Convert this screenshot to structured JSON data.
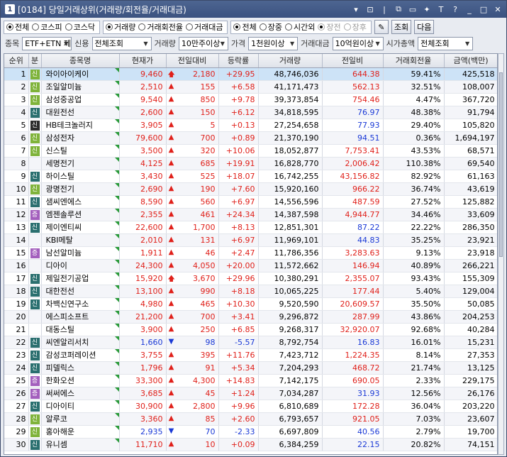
{
  "window": {
    "screen_no": "1",
    "title": "[0184] 당일거래상위(거래량/회전율/거래대금)"
  },
  "market_radios": [
    {
      "label": "전체",
      "selected": true
    },
    {
      "label": "코스피",
      "selected": false
    },
    {
      "label": "코스닥",
      "selected": false
    }
  ],
  "sort_radios": [
    {
      "label": "거래량",
      "selected": true
    },
    {
      "label": "거래회전율",
      "selected": false
    },
    {
      "label": "거래대금",
      "selected": false
    }
  ],
  "session_radios": [
    {
      "label": "전체",
      "selected": true,
      "disabled": false
    },
    {
      "label": "장중",
      "selected": false,
      "disabled": false
    },
    {
      "label": "시간외",
      "selected": false,
      "disabled": false
    },
    {
      "label": "장전",
      "selected": true,
      "disabled": true
    },
    {
      "label": "장후",
      "selected": false,
      "disabled": true
    }
  ],
  "buttons": {
    "query": "조회",
    "next": "다음"
  },
  "filters": {
    "stock_label": "종목",
    "stock_value": "ETF+ETN 제",
    "credit_label": "신용",
    "credit_value": "전체조회",
    "volume_label": "거래량",
    "volume_value": "10만주이상",
    "price_label": "가격",
    "price_value": "1천원이상",
    "amount_label": "거래대금",
    "amount_value": "10억원이상",
    "mcap_label": "시가총액",
    "mcap_value": "전체조회"
  },
  "columns": [
    "순위",
    "분",
    "종목명",
    "현재가",
    "전일대비",
    "등락률",
    "거래량",
    "전일비",
    "거래회전율",
    "금액(백만)"
  ],
  "rows": [
    {
      "rank": "1",
      "tag": "신",
      "tagc": "g",
      "name": "와이아이케이",
      "price": "9,460",
      "arrow": "up-big",
      "chg": "2,180",
      "rate": "+29.95",
      "vol": "48,746,036",
      "prev": "644.38",
      "prevc": "up",
      "turn": "59.41%",
      "amt": "425,518"
    },
    {
      "rank": "2",
      "tag": "신",
      "tagc": "g",
      "name": "조일알미늄",
      "price": "2,510",
      "arrow": "up",
      "chg": "155",
      "rate": "+6.58",
      "vol": "41,171,473",
      "prev": "562.13",
      "prevc": "up",
      "turn": "32.51%",
      "amt": "108,007"
    },
    {
      "rank": "3",
      "tag": "신",
      "tagc": "g",
      "name": "삼성중공업",
      "price": "9,540",
      "arrow": "up",
      "chg": "850",
      "rate": "+9.78",
      "vol": "39,373,854",
      "prev": "754.46",
      "prevc": "up",
      "turn": "4.47%",
      "amt": "367,720"
    },
    {
      "rank": "4",
      "tag": "신",
      "tagc": "t",
      "name": "대원전선",
      "price": "2,600",
      "arrow": "up",
      "chg": "150",
      "rate": "+6.12",
      "vol": "34,818,595",
      "prev": "76.97",
      "prevc": "dn",
      "turn": "48.38%",
      "amt": "91,794"
    },
    {
      "rank": "5",
      "tag": "신",
      "tagc": "b",
      "name": "HB테크놀러지",
      "price": "3,905",
      "arrow": "up",
      "chg": "5",
      "rate": "+0.13",
      "vol": "27,254,658",
      "prev": "77.93",
      "prevc": "dn",
      "turn": "29.40%",
      "amt": "105,820"
    },
    {
      "rank": "6",
      "tag": "신",
      "tagc": "g",
      "name": "삼성전자",
      "price": "79,600",
      "arrow": "up",
      "chg": "700",
      "rate": "+0.89",
      "vol": "21,370,190",
      "prev": "94.51",
      "prevc": "dn",
      "turn": "0.36%",
      "amt": "1,694,197"
    },
    {
      "rank": "7",
      "tag": "신",
      "tagc": "g",
      "name": "신스틸",
      "price": "3,500",
      "arrow": "up",
      "chg": "320",
      "rate": "+10.06",
      "vol": "18,052,877",
      "prev": "7,753.41",
      "prevc": "up",
      "turn": "43.53%",
      "amt": "68,571"
    },
    {
      "rank": "8",
      "tag": "",
      "tagc": "",
      "name": "세명전기",
      "price": "4,125",
      "arrow": "up",
      "chg": "685",
      "rate": "+19.91",
      "vol": "16,828,770",
      "prev": "2,006.42",
      "prevc": "up",
      "turn": "110.38%",
      "amt": "69,540"
    },
    {
      "rank": "9",
      "tag": "신",
      "tagc": "t",
      "name": "하이스틸",
      "price": "3,430",
      "arrow": "up",
      "chg": "525",
      "rate": "+18.07",
      "vol": "16,742,255",
      "prev": "43,156.82",
      "prevc": "up",
      "turn": "82.92%",
      "amt": "61,163"
    },
    {
      "rank": "10",
      "tag": "신",
      "tagc": "g",
      "name": "광명전기",
      "price": "2,690",
      "arrow": "up",
      "chg": "190",
      "rate": "+7.60",
      "vol": "15,920,160",
      "prev": "966.22",
      "prevc": "up",
      "turn": "36.74%",
      "amt": "43,619"
    },
    {
      "rank": "11",
      "tag": "신",
      "tagc": "t",
      "name": "샘씨엔에스",
      "price": "8,590",
      "arrow": "up",
      "chg": "560",
      "rate": "+6.97",
      "vol": "14,556,596",
      "prev": "487.59",
      "prevc": "up",
      "turn": "27.52%",
      "amt": "125,882"
    },
    {
      "rank": "12",
      "tag": "증",
      "tagc": "p",
      "name": "엠젠솔루션",
      "price": "2,355",
      "arrow": "up",
      "chg": "461",
      "rate": "+24.34",
      "vol": "14,387,598",
      "prev": "4,944.77",
      "prevc": "up",
      "turn": "34.46%",
      "amt": "33,609"
    },
    {
      "rank": "13",
      "tag": "신",
      "tagc": "t",
      "name": "제이엔티씨",
      "price": "22,600",
      "arrow": "up",
      "chg": "1,700",
      "rate": "+8.13",
      "vol": "12,851,301",
      "prev": "87.22",
      "prevc": "dn",
      "turn": "22.22%",
      "amt": "286,350"
    },
    {
      "rank": "14",
      "tag": "",
      "tagc": "",
      "name": "KBI메탈",
      "price": "2,010",
      "arrow": "up",
      "chg": "131",
      "rate": "+6.97",
      "vol": "11,969,101",
      "prev": "44.83",
      "prevc": "dn",
      "turn": "35.25%",
      "amt": "23,921"
    },
    {
      "rank": "15",
      "tag": "증",
      "tagc": "p",
      "name": "남선알미늄",
      "price": "1,911",
      "arrow": "up",
      "chg": "46",
      "rate": "+2.47",
      "vol": "11,786,356",
      "prev": "3,283.63",
      "prevc": "up",
      "turn": "9.13%",
      "amt": "23,918"
    },
    {
      "rank": "16",
      "tag": "",
      "tagc": "",
      "name": "디아이",
      "price": "24,300",
      "arrow": "up",
      "chg": "4,050",
      "rate": "+20.00",
      "vol": "11,572,662",
      "prev": "146.94",
      "prevc": "up",
      "turn": "40.89%",
      "amt": "266,221"
    },
    {
      "rank": "17",
      "tag": "신",
      "tagc": "t",
      "name": "제일전기공업",
      "price": "15,920",
      "arrow": "up-big",
      "chg": "3,670",
      "rate": "+29.96",
      "vol": "10,380,291",
      "prev": "2,355.07",
      "prevc": "up",
      "turn": "93.43%",
      "amt": "155,309"
    },
    {
      "rank": "18",
      "tag": "신",
      "tagc": "t",
      "name": "대한전선",
      "price": "13,100",
      "arrow": "up",
      "chg": "990",
      "rate": "+8.18",
      "vol": "10,065,225",
      "prev": "177.44",
      "prevc": "up",
      "turn": "5.40%",
      "amt": "129,004"
    },
    {
      "rank": "19",
      "tag": "신",
      "tagc": "t",
      "name": "차백신연구소",
      "price": "4,980",
      "arrow": "up",
      "chg": "465",
      "rate": "+10.30",
      "vol": "9,520,590",
      "prev": "20,609.57",
      "prevc": "up",
      "turn": "35.50%",
      "amt": "50,085"
    },
    {
      "rank": "20",
      "tag": "",
      "tagc": "",
      "name": "에스피소프트",
      "price": "21,200",
      "arrow": "up",
      "chg": "700",
      "rate": "+3.41",
      "vol": "9,296,872",
      "prev": "287.99",
      "prevc": "up",
      "turn": "43.86%",
      "amt": "204,253"
    },
    {
      "rank": "21",
      "tag": "",
      "tagc": "",
      "name": "대동스틸",
      "price": "3,900",
      "arrow": "up",
      "chg": "250",
      "rate": "+6.85",
      "vol": "9,268,317",
      "prev": "32,920.07",
      "prevc": "up",
      "turn": "92.68%",
      "amt": "40,284"
    },
    {
      "rank": "22",
      "tag": "신",
      "tagc": "t",
      "name": "씨엔알리서치",
      "price": "1,660",
      "arrow": "dn",
      "chg": "98",
      "rate": "-5.57",
      "vol": "8,792,754",
      "prev": "16.83",
      "prevc": "dn",
      "turn": "16.01%",
      "amt": "15,231"
    },
    {
      "rank": "23",
      "tag": "신",
      "tagc": "t",
      "name": "감성코퍼레이션",
      "price": "3,755",
      "arrow": "up",
      "chg": "395",
      "rate": "+11.76",
      "vol": "7,423,712",
      "prev": "1,224.35",
      "prevc": "up",
      "turn": "8.14%",
      "amt": "27,353"
    },
    {
      "rank": "24",
      "tag": "신",
      "tagc": "t",
      "name": "피델릭스",
      "price": "1,796",
      "arrow": "up",
      "chg": "91",
      "rate": "+5.34",
      "vol": "7,204,293",
      "prev": "468.72",
      "prevc": "up",
      "turn": "21.74%",
      "amt": "13,125"
    },
    {
      "rank": "25",
      "tag": "증",
      "tagc": "p",
      "name": "한화오션",
      "price": "33,300",
      "arrow": "up",
      "chg": "4,300",
      "rate": "+14.83",
      "vol": "7,142,175",
      "prev": "690.05",
      "prevc": "up",
      "turn": "2.33%",
      "amt": "229,175"
    },
    {
      "rank": "26",
      "tag": "증",
      "tagc": "p",
      "name": "써써에스",
      "price": "3,685",
      "arrow": "up",
      "chg": "45",
      "rate": "+1.24",
      "vol": "7,034,287",
      "prev": "31.93",
      "prevc": "dn",
      "turn": "12.56%",
      "amt": "26,176"
    },
    {
      "rank": "27",
      "tag": "신",
      "tagc": "t",
      "name": "디아이티",
      "price": "30,900",
      "arrow": "up",
      "chg": "2,800",
      "rate": "+9.96",
      "vol": "6,810,689",
      "prev": "172.28",
      "prevc": "up",
      "turn": "36.04%",
      "amt": "203,220"
    },
    {
      "rank": "28",
      "tag": "신",
      "tagc": "g",
      "name": "알루코",
      "price": "3,360",
      "arrow": "up",
      "chg": "85",
      "rate": "+2.60",
      "vol": "6,793,657",
      "prev": "921.05",
      "prevc": "up",
      "turn": "7.03%",
      "amt": "23,607"
    },
    {
      "rank": "29",
      "tag": "신",
      "tagc": "g",
      "name": "홍아해운",
      "price": "2,935",
      "arrow": "dn",
      "chg": "70",
      "rate": "-2.33",
      "vol": "6,697,809",
      "prev": "40.56",
      "prevc": "dn",
      "turn": "2.79%",
      "amt": "19,700"
    },
    {
      "rank": "30",
      "tag": "신",
      "tagc": "t",
      "name": "유니셈",
      "price": "11,710",
      "arrow": "up",
      "chg": "10",
      "rate": "+0.09",
      "vol": "6,384,259",
      "prev": "22.15",
      "prevc": "dn",
      "turn": "20.82%",
      "amt": "74,151"
    }
  ]
}
